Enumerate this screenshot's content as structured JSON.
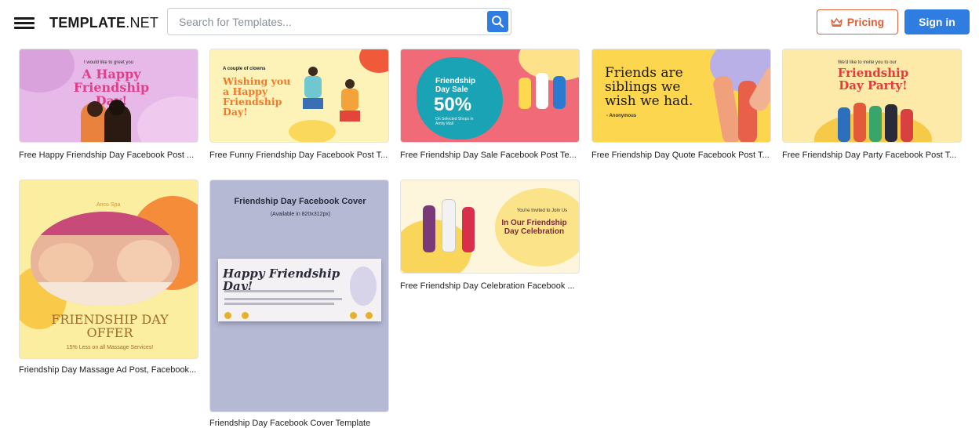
{
  "header": {
    "logo_bold": "TEMPLATE",
    "logo_light": ".NET",
    "search_placeholder": "Search for Templates...",
    "pricing_label": "Pricing",
    "signin_label": "Sign in"
  },
  "templates": [
    {
      "caption": "Free Happy Friendship Day Facebook Post ...",
      "thumb_small": "I would like to greet you",
      "thumb_title": "A Happy Friendship Day!"
    },
    {
      "caption": "Free Funny Friendship Day Facebook Post T...",
      "thumb_small": "A couple of clowns",
      "thumb_title": "Wishing you a Happy Friendship Day!"
    },
    {
      "caption": "Free Friendship Day Sale Facebook Post Te...",
      "thumb_title": "Friendship Day Sale",
      "thumb_big": "50%",
      "thumb_small": "On Selected Shops in Amity Mall"
    },
    {
      "caption": "Free Friendship Day Quote Facebook Post T...",
      "thumb_title": "Friends are siblings we wish we had.",
      "thumb_small": "- Anonymous"
    },
    {
      "caption": "Free Friendship Day Party Facebook Post T...",
      "thumb_small": "We'd like to invite you to our",
      "thumb_title": "Friendship Day Party!"
    },
    {
      "caption": "Friendship Day Massage Ad Post, Facebook...",
      "thumb_small": "Anco Spa",
      "thumb_title": "FRIENDSHIP DAY OFFER",
      "thumb_sub": "15% Less on all Massage Services!"
    },
    {
      "caption": "Friendship Day Facebook Cover Template",
      "thumb_title": "Friendship Day Facebook Cover",
      "thumb_sub": "(Available in 820x312px)",
      "thumb_banner": "Happy Friendship Day!"
    },
    {
      "caption": "Free Friendship Day Celebration Facebook ...",
      "thumb_small": "You're Invited to Join Us",
      "thumb_title": "In Our Friendship Day Celebration"
    }
  ],
  "colors": {
    "accent_blue": "#2f7de1",
    "pricing_orange": "#e0603a"
  }
}
